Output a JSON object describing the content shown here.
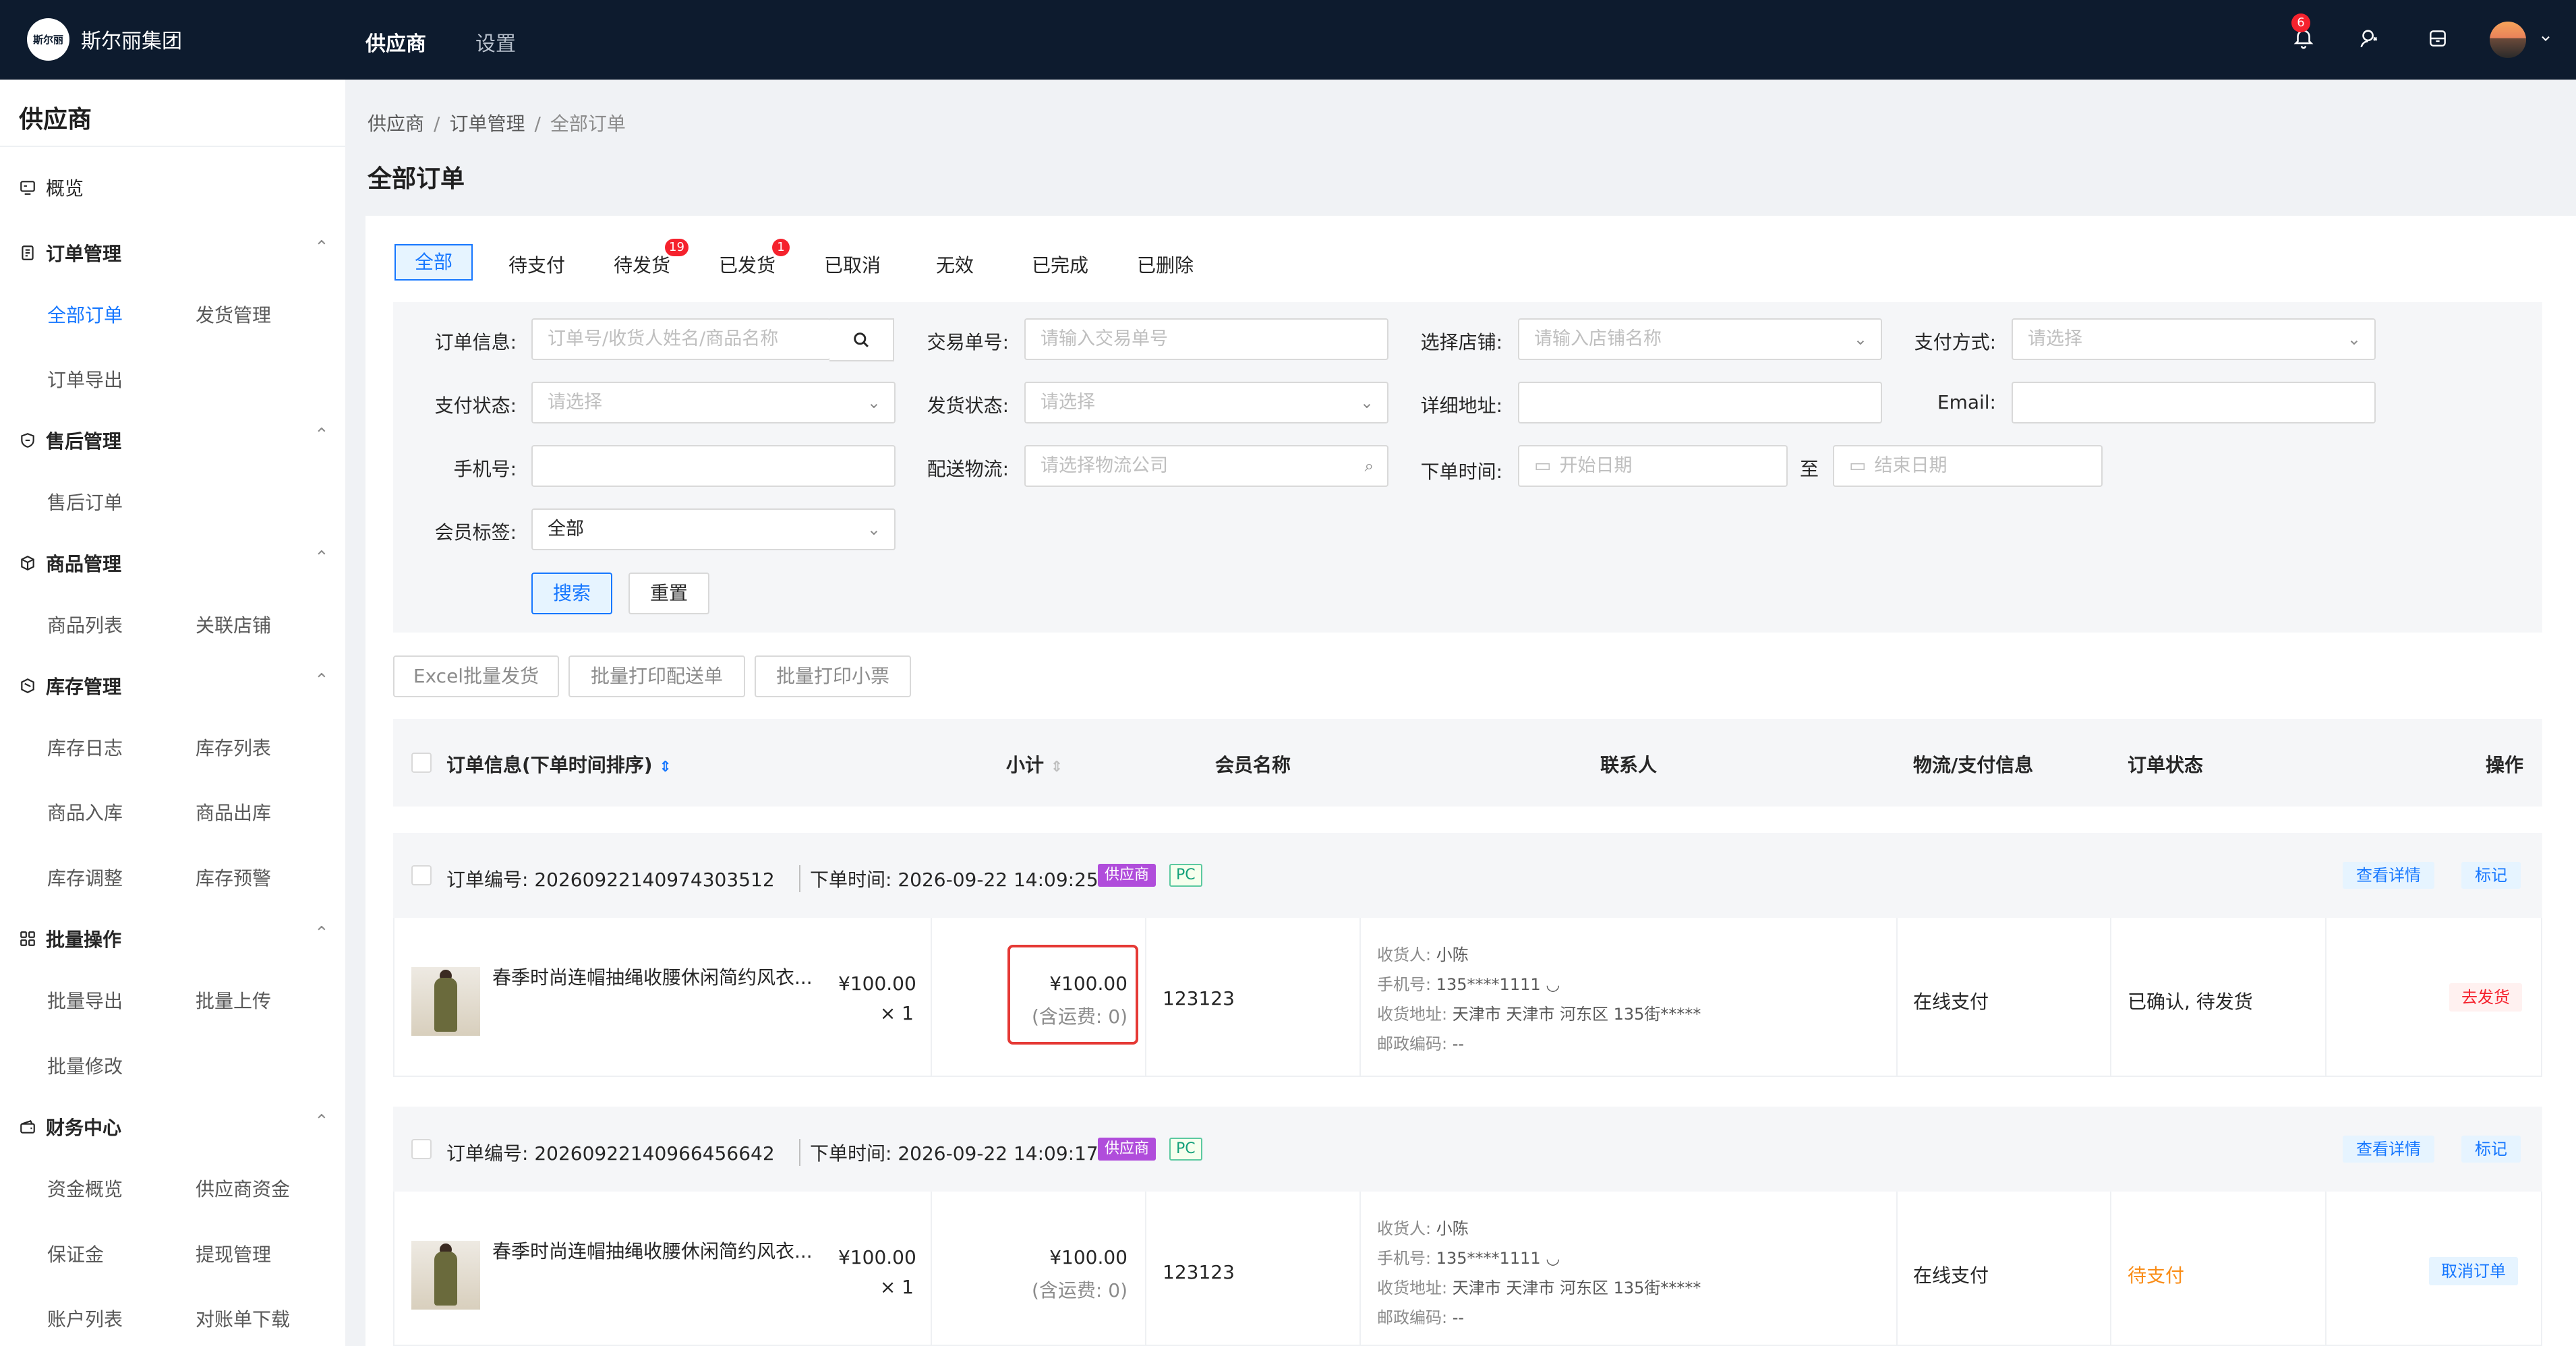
{
  "header": {
    "logo_text": "斯尔丽",
    "brand": "斯尔丽集团",
    "nav": [
      {
        "label": "供应商",
        "active": true
      },
      {
        "label": "设置",
        "active": false
      }
    ],
    "notification_count": "6",
    "icons": [
      "bell-icon",
      "support-icon",
      "store-icon",
      "avatar",
      "chevron-down-icon"
    ]
  },
  "sidebar": {
    "title": "供应商",
    "overview": "概览",
    "groups": [
      {
        "label": "订单管理",
        "items": [
          "全部订单",
          "发货管理",
          "订单导出"
        ]
      },
      {
        "label": "售后管理",
        "items": [
          "售后订单"
        ]
      },
      {
        "label": "商品管理",
        "items": [
          "商品列表",
          "关联店铺"
        ]
      },
      {
        "label": "库存管理",
        "items": [
          "库存日志",
          "库存列表",
          "商品入库",
          "商品出库",
          "库存调整",
          "库存预警"
        ]
      },
      {
        "label": "批量操作",
        "items": [
          "批量导出",
          "批量上传",
          "批量修改"
        ]
      },
      {
        "label": "财务中心",
        "items": [
          "资金概览",
          "供应商资金",
          "保证金",
          "提现管理",
          "账户列表",
          "对账单下载"
        ]
      }
    ],
    "active_item": "全部订单"
  },
  "breadcrumb": {
    "items": [
      "供应商",
      "订单管理",
      "全部订单"
    ],
    "sep": "/"
  },
  "page_title": "全部订单",
  "tabs": [
    {
      "label": "全部"
    },
    {
      "label": "待支付"
    },
    {
      "label": "待发货",
      "badge": "19"
    },
    {
      "label": "已发货",
      "badge": "1"
    },
    {
      "label": "已取消"
    },
    {
      "label": "无效"
    },
    {
      "label": "已完成"
    },
    {
      "label": "已删除"
    }
  ],
  "filters": {
    "order_info": {
      "label": "订单信息:",
      "placeholder": "订单号/收货人姓名/商品名称"
    },
    "trade_no": {
      "label": "交易单号:",
      "placeholder": "请输入交易单号"
    },
    "store": {
      "label": "选择店铺:",
      "placeholder": "请输入店铺名称"
    },
    "pay_method": {
      "label": "支付方式:",
      "placeholder": "请选择"
    },
    "pay_status": {
      "label": "支付状态:",
      "placeholder": "请选择"
    },
    "ship_status": {
      "label": "发货状态:",
      "placeholder": "请选择"
    },
    "address": {
      "label": "详细地址:",
      "value": ""
    },
    "email": {
      "label": "Email:",
      "value": ""
    },
    "phone": {
      "label": "手机号:",
      "value": ""
    },
    "logistics": {
      "label": "配送物流:",
      "placeholder": "请选择物流公司"
    },
    "order_time": {
      "label": "下单时间:",
      "start": "开始日期",
      "to": "至",
      "end": "结束日期"
    },
    "member_tag": {
      "label": "会员标签:",
      "value": "全部"
    },
    "search_btn": "搜索",
    "reset_btn": "重置"
  },
  "batch": {
    "excel": "Excel批量发货",
    "print_delivery": "批量打印配送单",
    "print_receipt": "批量打印小票"
  },
  "table": {
    "columns": [
      "订单信息(下单时间排序)",
      "小计",
      "会员名称",
      "联系人",
      "物流/支付信息",
      "订单状态",
      "操作"
    ]
  },
  "orders": [
    {
      "no_label": "订单编号:",
      "no": "20260922140974303512",
      "time_label": "下单时间:",
      "time": "2026-09-22 14:09:25",
      "tag1": "供应商",
      "tag2": "PC",
      "detail_btn": "查看详情",
      "mark_btn": "标记",
      "product": "春季时尚连帽抽绳收腰休闲简约风衣...",
      "price": "¥100.00",
      "qty": "× 1",
      "subtotal": "¥100.00",
      "shipping": "(含运费: 0)",
      "member": "123123",
      "contact": {
        "name_l": "收货人:",
        "name": "小陈",
        "phone_l": "手机号:",
        "phone": "135****1111",
        "addr_l": "收货地址:",
        "addr": "天津市 天津市 河东区 135街*****",
        "zip_l": "邮政编码:",
        "zip": "--"
      },
      "payment": "在线支付",
      "status": "已确认, 待发货",
      "action": "去发货"
    },
    {
      "no_label": "订单编号:",
      "no": "20260922140966456642",
      "time_label": "下单时间:",
      "time": "2026-09-22 14:09:17",
      "tag1": "供应商",
      "tag2": "PC",
      "detail_btn": "查看详情",
      "mark_btn": "标记",
      "product": "春季时尚连帽抽绳收腰休闲简约风衣...",
      "price": "¥100.00",
      "qty": "× 1",
      "subtotal": "¥100.00",
      "shipping": "(含运费: 0)",
      "member": "123123",
      "contact": {
        "name_l": "收货人:",
        "name": "小陈",
        "phone_l": "手机号:",
        "phone": "135****1111",
        "addr_l": "收货地址:",
        "addr": "天津市 天津市 河东区 135街*****",
        "zip_l": "邮政编码:",
        "zip": "--"
      },
      "payment": "在线支付",
      "status": "待支付",
      "action": "取消订单"
    }
  ],
  "colors": {
    "header_bg": "#0d1b2e",
    "primary": "#1677ff",
    "danger": "#f5222d",
    "warning": "#fa8c16",
    "supplier_tag": "#b04ddb",
    "highlight_box": "#e53935"
  }
}
